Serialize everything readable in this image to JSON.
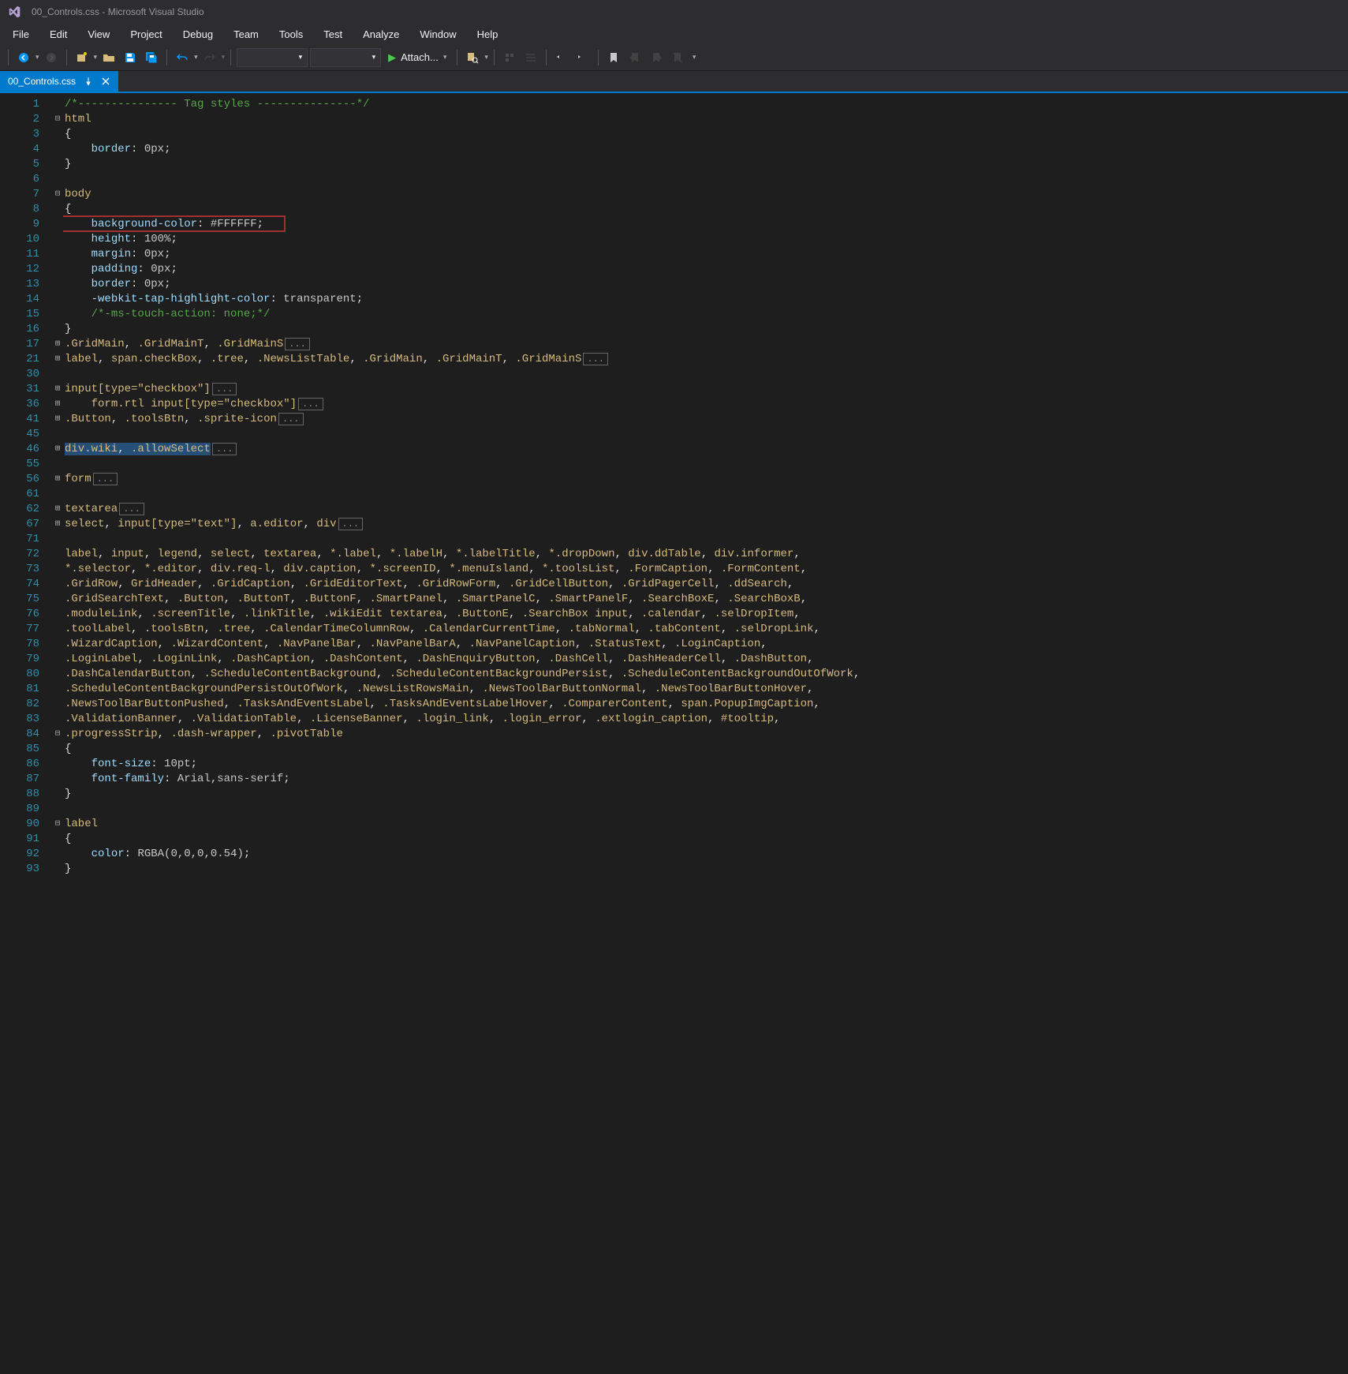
{
  "window": {
    "title": "00_Controls.css - Microsoft Visual Studio"
  },
  "menu": {
    "items": [
      "File",
      "Edit",
      "View",
      "Project",
      "Debug",
      "Team",
      "Tools",
      "Test",
      "Analyze",
      "Window",
      "Help"
    ]
  },
  "toolbar": {
    "attach_label": "Attach..."
  },
  "tab": {
    "label": "00_Controls.css"
  },
  "lines": [
    {
      "num": 1,
      "fold": "",
      "html": "<span class='c-comment'>/*--------------- Tag styles ---------------*/</span>"
    },
    {
      "num": 2,
      "fold": "⊟",
      "html": "<span class='c-selector'>html</span>"
    },
    {
      "num": 3,
      "fold": "",
      "html": "<span class='c-punc'>{</span>"
    },
    {
      "num": 4,
      "fold": "",
      "html": "    <span class='c-prop'>border</span><span class='c-punc'>:</span> <span class='c-value'>0px</span><span class='c-punc'>;</span>"
    },
    {
      "num": 5,
      "fold": "",
      "html": "<span class='c-punc'>}</span>"
    },
    {
      "num": 6,
      "fold": "",
      "html": ""
    },
    {
      "num": 7,
      "fold": "⊟",
      "html": "<span class='c-selector'>body</span>"
    },
    {
      "num": 8,
      "fold": "",
      "html": "<span class='c-punc'>{</span>"
    },
    {
      "num": 9,
      "fold": "",
      "html": "    <span class='c-prop'>background-color</span><span class='c-punc'>:</span> <span class='c-value'>#FFFFFF</span><span class='c-punc'>;</span>",
      "highlight": true
    },
    {
      "num": 10,
      "fold": "",
      "html": "    <span class='c-prop'>height</span><span class='c-punc'>:</span> <span class='c-value'>100%</span><span class='c-punc'>;</span>"
    },
    {
      "num": 11,
      "fold": "",
      "html": "    <span class='c-prop'>margin</span><span class='c-punc'>:</span> <span class='c-value'>0px</span><span class='c-punc'>;</span>"
    },
    {
      "num": 12,
      "fold": "",
      "html": "    <span class='c-prop'>padding</span><span class='c-punc'>:</span> <span class='c-value'>0px</span><span class='c-punc'>;</span>"
    },
    {
      "num": 13,
      "fold": "",
      "html": "    <span class='c-prop'>border</span><span class='c-punc'>:</span> <span class='c-value'>0px</span><span class='c-punc'>;</span>"
    },
    {
      "num": 14,
      "fold": "",
      "html": "    <span class='c-prop'>-webkit-tap-highlight-color</span><span class='c-punc'>:</span> <span class='c-value'>transparent</span><span class='c-punc'>;</span>"
    },
    {
      "num": 15,
      "fold": "",
      "html": "    <span class='c-comment'>/*-ms-touch-action: none;*/</span>"
    },
    {
      "num": 16,
      "fold": "",
      "html": "<span class='c-punc'>}</span>"
    },
    {
      "num": 17,
      "fold": "⊞",
      "html": "<span class='c-selector'>.GridMain</span><span class='c-punc'>,</span> <span class='c-selector'>.GridMainT</span><span class='c-punc'>,</span> <span class='c-selector'>.GridMainS</span><span class='c-collapsed'>...</span>"
    },
    {
      "num": 21,
      "fold": "⊞",
      "html": "<span class='c-selector'>label</span><span class='c-punc'>,</span> <span class='c-selector'>span.checkBox</span><span class='c-punc'>,</span> <span class='c-selector'>.tree</span><span class='c-punc'>,</span> <span class='c-selector'>.NewsListTable</span><span class='c-punc'>,</span> <span class='c-selector'>.GridMain</span><span class='c-punc'>,</span> <span class='c-selector'>.GridMainT</span><span class='c-punc'>,</span> <span class='c-selector'>.GridMainS</span><span class='c-collapsed'>...</span>"
    },
    {
      "num": 30,
      "fold": "",
      "html": ""
    },
    {
      "num": 31,
      "fold": "⊞",
      "html": "<span class='c-selector'>input[type=\"checkbox\"]</span><span class='c-collapsed'>...</span>"
    },
    {
      "num": 36,
      "fold": "⊞",
      "html": "    <span class='c-selector'>form.rtl input[type=\"checkbox\"]</span><span class='c-collapsed'>...</span>"
    },
    {
      "num": 41,
      "fold": "⊞",
      "html": "<span class='c-selector'>.Button</span><span class='c-punc'>,</span> <span class='c-selector'>.toolsBtn</span><span class='c-punc'>,</span> <span class='c-selector'>.sprite-icon</span><span class='c-collapsed'>...</span>"
    },
    {
      "num": 45,
      "fold": "",
      "html": ""
    },
    {
      "num": 46,
      "fold": "⊞",
      "html": "<span class='sel'><span class='c-selector'>div.wiki</span><span class='c-punc'>,</span> <span class='c-selector'>.allowSelect</span></span><span class='c-collapsed'>...</span>"
    },
    {
      "num": 55,
      "fold": "",
      "html": ""
    },
    {
      "num": 56,
      "fold": "⊞",
      "html": "<span class='c-selector'>form</span><span class='c-collapsed'>...</span>"
    },
    {
      "num": 61,
      "fold": "",
      "html": ""
    },
    {
      "num": 62,
      "fold": "⊞",
      "html": "<span class='c-selector'>textarea</span><span class='c-collapsed'>...</span>"
    },
    {
      "num": 67,
      "fold": "⊞",
      "html": "<span class='c-selector'>select</span><span class='c-punc'>,</span> <span class='c-selector'>input[type=\"text\"]</span><span class='c-punc'>,</span> <span class='c-selector'>a.editor</span><span class='c-punc'>,</span> <span class='c-selector'>div</span><span class='c-collapsed'>...</span>"
    },
    {
      "num": 71,
      "fold": "",
      "html": ""
    },
    {
      "num": 72,
      "fold": "",
      "html": "<span class='c-selector'>label</span><span class='c-punc'>,</span> <span class='c-selector'>input</span><span class='c-punc'>,</span> <span class='c-selector'>legend</span><span class='c-punc'>,</span> <span class='c-selector'>select</span><span class='c-punc'>,</span> <span class='c-selector'>textarea</span><span class='c-punc'>,</span> <span class='c-selector'>*.label</span><span class='c-punc'>,</span> <span class='c-selector'>*.labelH</span><span class='c-punc'>,</span> <span class='c-selector'>*.labelTitle</span><span class='c-punc'>,</span> <span class='c-selector'>*.dropDown</span><span class='c-punc'>,</span> <span class='c-selector'>div.ddTable</span><span class='c-punc'>,</span> <span class='c-selector'>div.informer</span><span class='c-punc'>,</span>"
    },
    {
      "num": 73,
      "fold": "",
      "html": "<span class='c-selector'>*.selector</span><span class='c-punc'>,</span> <span class='c-selector'>*.editor</span><span class='c-punc'>,</span> <span class='c-selector'>div.req-l</span><span class='c-punc'>,</span> <span class='c-selector'>div.caption</span><span class='c-punc'>,</span> <span class='c-selector'>*.screenID</span><span class='c-punc'>,</span> <span class='c-selector'>*.menuIsland</span><span class='c-punc'>,</span> <span class='c-selector'>*.toolsList</span><span class='c-punc'>,</span> <span class='c-selector'>.FormCaption</span><span class='c-punc'>,</span> <span class='c-selector'>.FormContent</span><span class='c-punc'>,</span>"
    },
    {
      "num": 74,
      "fold": "",
      "html": "<span class='c-selector'>.GridRow</span><span class='c-punc'>,</span> <span class='c-selector'>GridHeader</span><span class='c-punc'>,</span> <span class='c-selector'>.GridCaption</span><span class='c-punc'>,</span> <span class='c-selector'>.GridEditorText</span><span class='c-punc'>,</span> <span class='c-selector'>.GridRowForm</span><span class='c-punc'>,</span> <span class='c-selector'>.GridCellButton</span><span class='c-punc'>,</span> <span class='c-selector'>.GridPagerCell</span><span class='c-punc'>,</span> <span class='c-selector'>.ddSearch</span><span class='c-punc'>,</span>"
    },
    {
      "num": 75,
      "fold": "",
      "html": "<span class='c-selector'>.GridSearchText</span><span class='c-punc'>,</span> <span class='c-selector'>.Button</span><span class='c-punc'>,</span> <span class='c-selector'>.ButtonT</span><span class='c-punc'>,</span> <span class='c-selector'>.ButtonF</span><span class='c-punc'>,</span> <span class='c-selector'>.SmartPanel</span><span class='c-punc'>,</span> <span class='c-selector'>.SmartPanelC</span><span class='c-punc'>,</span> <span class='c-selector'>.SmartPanelF</span><span class='c-punc'>,</span> <span class='c-selector'>.SearchBoxE</span><span class='c-punc'>,</span> <span class='c-selector'>.SearchBoxB</span><span class='c-punc'>,</span>"
    },
    {
      "num": 76,
      "fold": "",
      "html": "<span class='c-selector'>.moduleLink</span><span class='c-punc'>,</span> <span class='c-selector'>.screenTitle</span><span class='c-punc'>,</span> <span class='c-selector'>.linkTitle</span><span class='c-punc'>,</span> <span class='c-selector'>.wikiEdit textarea</span><span class='c-punc'>,</span> <span class='c-selector'>.ButtonE</span><span class='c-punc'>,</span> <span class='c-selector'>.SearchBox input</span><span class='c-punc'>,</span> <span class='c-selector'>.calendar</span><span class='c-punc'>,</span> <span class='c-selector'>.selDropItem</span><span class='c-punc'>,</span>"
    },
    {
      "num": 77,
      "fold": "",
      "html": "<span class='c-selector'>.toolLabel</span><span class='c-punc'>,</span> <span class='c-selector'>.toolsBtn</span><span class='c-punc'>,</span> <span class='c-selector'>.tree</span><span class='c-punc'>,</span> <span class='c-selector'>.CalendarTimeColumnRow</span><span class='c-punc'>,</span> <span class='c-selector'>.CalendarCurrentTime</span><span class='c-punc'>,</span> <span class='c-selector'>.tabNormal</span><span class='c-punc'>,</span> <span class='c-selector'>.tabContent</span><span class='c-punc'>,</span> <span class='c-selector'>.selDropLink</span><span class='c-punc'>,</span>"
    },
    {
      "num": 78,
      "fold": "",
      "html": "<span class='c-selector'>.WizardCaption</span><span class='c-punc'>,</span> <span class='c-selector'>.WizardContent</span><span class='c-punc'>,</span> <span class='c-selector'>.NavPanelBar</span><span class='c-punc'>,</span> <span class='c-selector'>.NavPanelBarA</span><span class='c-punc'>,</span> <span class='c-selector'>.NavPanelCaption</span><span class='c-punc'>,</span> <span class='c-selector'>.StatusText</span><span class='c-punc'>,</span> <span class='c-selector'>.LoginCaption</span><span class='c-punc'>,</span>"
    },
    {
      "num": 79,
      "fold": "",
      "html": "<span class='c-selector'>.LoginLabel</span><span class='c-punc'>,</span> <span class='c-selector'>.LoginLink</span><span class='c-punc'>,</span> <span class='c-selector'>.DashCaption</span><span class='c-punc'>,</span> <span class='c-selector'>.DashContent</span><span class='c-punc'>,</span> <span class='c-selector'>.DashEnquiryButton</span><span class='c-punc'>,</span> <span class='c-selector'>.DashCell</span><span class='c-punc'>,</span> <span class='c-selector'>.DashHeaderCell</span><span class='c-punc'>,</span> <span class='c-selector'>.DashButton</span><span class='c-punc'>,</span>"
    },
    {
      "num": 80,
      "fold": "",
      "html": "<span class='c-selector'>.DashCalendarButton</span><span class='c-punc'>,</span> <span class='c-selector'>.ScheduleContentBackground</span><span class='c-punc'>,</span> <span class='c-selector'>.ScheduleContentBackgroundPersist</span><span class='c-punc'>,</span> <span class='c-selector'>.ScheduleContentBackgroundOutOfWork</span><span class='c-punc'>,</span>"
    },
    {
      "num": 81,
      "fold": "",
      "html": "<span class='c-selector'>.ScheduleContentBackgroundPersistOutOfWork</span><span class='c-punc'>,</span> <span class='c-selector'>.NewsListRowsMain</span><span class='c-punc'>,</span> <span class='c-selector'>.NewsToolBarButtonNormal</span><span class='c-punc'>,</span> <span class='c-selector'>.NewsToolBarButtonHover</span><span class='c-punc'>,</span>"
    },
    {
      "num": 82,
      "fold": "",
      "html": "<span class='c-selector'>.NewsToolBarButtonPushed</span><span class='c-punc'>,</span> <span class='c-selector'>.TasksAndEventsLabel</span><span class='c-punc'>,</span> <span class='c-selector'>.TasksAndEventsLabelHover</span><span class='c-punc'>,</span> <span class='c-selector'>.ComparerContent</span><span class='c-punc'>,</span> <span class='c-selector'>span.PopupImgCaption</span><span class='c-punc'>,</span>"
    },
    {
      "num": 83,
      "fold": "",
      "html": "<span class='c-selector'>.ValidationBanner</span><span class='c-punc'>,</span> <span class='c-selector'>.ValidationTable</span><span class='c-punc'>,</span> <span class='c-selector'>.LicenseBanner</span><span class='c-punc'>,</span> <span class='c-selector'>.login_link</span><span class='c-punc'>,</span> <span class='c-selector'>.login_error</span><span class='c-punc'>,</span> <span class='c-selector'>.extlogin_caption</span><span class='c-punc'>,</span> <span class='c-selector'>#tooltip</span><span class='c-punc'>,</span>"
    },
    {
      "num": 84,
      "fold": "⊟",
      "html": "<span class='c-selector'>.progressStrip</span><span class='c-punc'>,</span> <span class='c-selector'>.dash-wrapper</span><span class='c-punc'>,</span> <span class='c-selector'>.pivotTable</span>"
    },
    {
      "num": 85,
      "fold": "",
      "html": "<span class='c-punc'>{</span>"
    },
    {
      "num": 86,
      "fold": "",
      "html": "    <span class='c-prop'>font-size</span><span class='c-punc'>:</span> <span class='c-value'>10pt</span><span class='c-punc'>;</span>"
    },
    {
      "num": 87,
      "fold": "",
      "html": "    <span class='c-prop'>font-family</span><span class='c-punc'>:</span> <span class='c-value'>Arial,sans-serif</span><span class='c-punc'>;</span>"
    },
    {
      "num": 88,
      "fold": "",
      "html": "<span class='c-punc'>}</span>"
    },
    {
      "num": 89,
      "fold": "",
      "html": ""
    },
    {
      "num": 90,
      "fold": "⊟",
      "html": "<span class='c-selector'>label</span>"
    },
    {
      "num": 91,
      "fold": "",
      "html": "<span class='c-punc'>{</span>"
    },
    {
      "num": 92,
      "fold": "",
      "html": "    <span class='c-prop'>color</span><span class='c-punc'>:</span> <span class='c-value'>RGBA(0,0,0,0.54)</span><span class='c-punc'>;</span>"
    },
    {
      "num": 93,
      "fold": "",
      "html": "<span class='c-punc'>}</span>"
    }
  ]
}
